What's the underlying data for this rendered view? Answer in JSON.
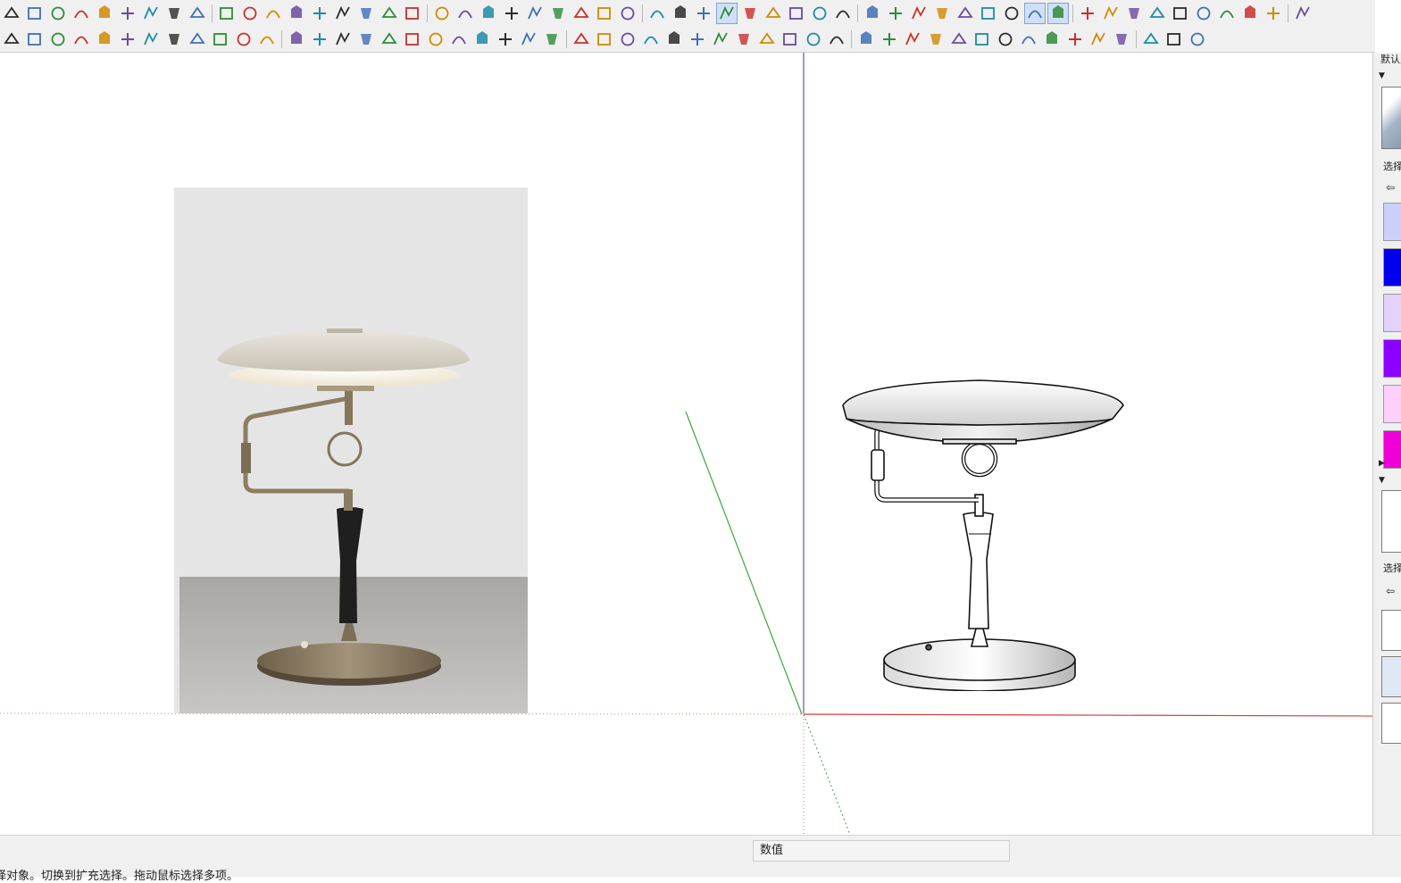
{
  "app": {
    "name": "SketchUp"
  },
  "toolbar_row1": {
    "icons": [
      "extension-icon",
      "dimension-icon",
      "tape-icon",
      "protractor-icon",
      "arc-tool-icon",
      "rotate-icon",
      "offset-icon",
      "follow-me-icon",
      "paint-icon",
      "push-pull-icon",
      "scale-icon",
      "move-icon",
      "intersect-icon",
      "bevel-icon",
      "chain-icon",
      "spring-icon",
      "twist-icon",
      "ruby-icon",
      "loft-icon",
      "sweep-icon",
      "mirror-icon",
      "array-icon",
      "solid-icon",
      "flag-icon",
      "broom-icon",
      "camera-icon",
      "look-around-icon",
      "xray-icon",
      "wireframe-icon",
      "hidden-line-icon",
      "shaded-icon",
      "shaded-texture-icon",
      "monochrome-icon",
      "iso-view-icon",
      "top-view-icon",
      "front-view-icon",
      "right-view-icon",
      "back-view-icon",
      "left-view-icon",
      "axes-icon",
      "section-icon",
      "section-display-icon",
      "section-cut-icon",
      "curve-icon",
      "bezier-icon",
      "freehand-icon",
      "spline-icon",
      "polyline-icon",
      "arc-2-icon",
      "rectangle-icon",
      "circle-icon",
      "arc-3-icon",
      "pie-icon",
      "smooth-icon",
      "extend-icon"
    ]
  },
  "toolbar_row2": {
    "icons": [
      "line-tool-icon",
      "eraser-icon",
      "box-icon",
      "cylinder-icon",
      "edge-tool-icon",
      "lasso-icon",
      "soften-icon",
      "weld-icon",
      "bend-icon",
      "fillet-icon",
      "chamfer-icon",
      "curviloft-icon",
      "shell-icon",
      "joint-push-icon",
      "vertex-icon",
      "flowify-icon",
      "smooth-2-icon",
      "random-icon",
      "grid-icon",
      "label-icon",
      "stair-icon",
      "roof-icon",
      "window-icon",
      "wall-icon",
      "floor-icon",
      "frame-icon",
      "truss-icon",
      "fence-icon",
      "path-icon",
      "terrain-icon",
      "cloud-icon",
      "hatch-icon",
      "rail-icon",
      "planks-icon",
      "stack-icon",
      "pattern-icon",
      "facade-icon",
      "skin-icon",
      "mesh-icon",
      "stretch-icon",
      "export-icon",
      "import-icon",
      "render-icon",
      "shield-icon",
      "material-icon",
      "leaf-icon",
      "home-icon",
      "upload-icon",
      "cube-icon",
      "gem-icon",
      "undo-icon"
    ]
  },
  "viewport": {
    "reference_image": "lamp-photo",
    "model": "lamp-model-hidden-line",
    "axis_colors": {
      "red": "#d23b3b",
      "green": "#39a839",
      "blue": "#3a3aa6"
    }
  },
  "right_panel": {
    "header_default": "默认人",
    "section_select_1": "选择",
    "section_select_2": "选择",
    "swatches": [
      "#cccff9",
      "#0000ee",
      "#e4d2fa",
      "#8b00ff",
      "#fdd0fb",
      "#f000d8"
    ]
  },
  "status_bar": {
    "vcb_label": "数值",
    "hint_text": "择对象。切换到扩充选择。拖动鼠标选择多项。"
  }
}
